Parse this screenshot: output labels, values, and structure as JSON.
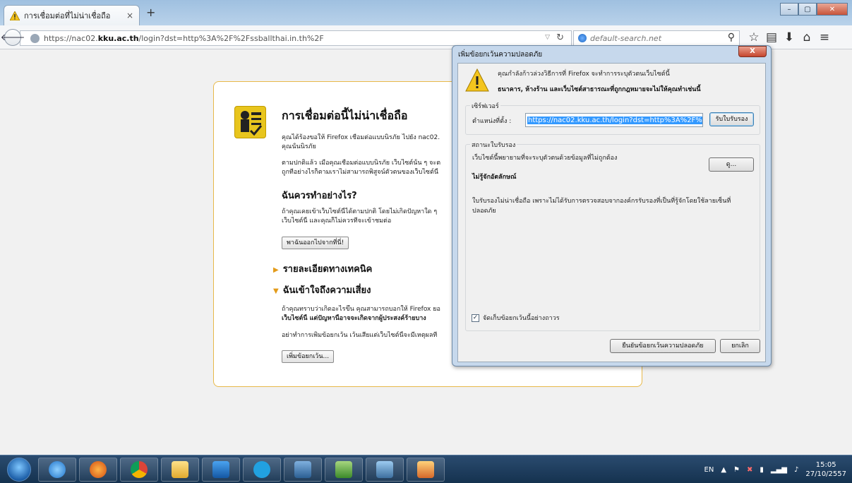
{
  "tab": {
    "title": "การเชื่อมต่อที่ไม่น่าเชื่อถือ",
    "close": "×",
    "new_tab": "+"
  },
  "window_controls": {
    "minimize": "–",
    "maximize": "▢",
    "close": "✕"
  },
  "navbar": {
    "url_prefix": "https://nac02.",
    "url_domain": "kku.ac.th",
    "url_rest": "/login?dst=http%3A%2F%2Fssballthai.in.th%2F",
    "search_placeholder": "default-search.net"
  },
  "error_page": {
    "title": "การเชื่อมต่อนี้ไม่น่าเชื่อถือ",
    "intro_1": "คุณได้ร้องขอให้ Firefox เชื่อมต่อแบบนิรภัย ไปยัง nac02.",
    "intro_2": "คุณนั้นนิรภัย",
    "normal_1": "ตามปกติแล้ว เมื่อคุณเชื่อมต่อแบบนิรภัย เว็บไซต์นั้น ๆ จะต",
    "normal_2": "ถูกที่อย่างไรก็ตามเราไม่สามารถพิสูจน์ตัวตนของเว็บไซต์นี้",
    "what_heading": "ฉันควรทำอย่างไร?",
    "what_1": "ถ้าคุณเคยเข้าเว็บไซต์นี้ได้ตามปกติ โดยไม่เกิดปัญหาใด ๆ",
    "what_2": "เว็บไซต์นี้ และคุณก็ไม่ควรที่จะเข้าชมต่อ",
    "get_out_button": "พาฉันออกไปจากที่นี่!",
    "technical_details": "รายละเอียดทางเทคนิค",
    "understand_risks": "ฉันเข้าใจถึงความเสี่ยง",
    "risk_1": "ถ้าคุณทราบว่าเกิดอะไรขึ้น คุณสามารถบอกให้ Firefox ยอ",
    "risk_2": "เว็บไซต์นี้ แต่ปัญหานี้อาจจะเกิดจากผู้ประสงค์ร้ายบาง",
    "risk_3": "อย่าทำการเพิ่มข้อยกเว้น เว้นเสียแต่เว็บไซต์นี้จะมีเหตุผลที่",
    "add_exception_button": "เพิ่มข้อยกเว้น..."
  },
  "dialog": {
    "title": "เพิ่มข้อยกเว้นความปลอดภัย",
    "close": "X",
    "warning_line": "คุณกำลังก้าวล่วงวิธีการที่ Firefox จะทำการระบุตัวตนเว็บไซต์นี้",
    "warning_bold": "ธนาคาร, ห้างร้าน และเว็บไซต์สาธารณะที่ถูกกฎหมายจะไม่ให้คุณทำเช่นนี้",
    "server_group": "เซิร์ฟเวอร์",
    "location_label": "ตำแหน่งที่ตั้ง :",
    "location_value": "https://nac02.kku.ac.th/login?dst=http%3A%2F%2Fssb",
    "get_cert_button": "รับใบรับรอง",
    "cert_status_group": "สถานะใบรับรอง",
    "cert_status_text": "เว็บไซต์นี้พยายามที่จะระบุตัวตนด้วยข้อมูลที่ไม่ถูกต้อง",
    "view_button": "ดู...",
    "unknown_identity": "ไม่รู้จักอัตลักษณ์",
    "untrusted_1": "ใบรับรองไม่น่าเชื่อถือ เพราะไม่ได้รับการตรวจสอบจากองค์กรรับรองที่เป็นที่รู้จักโดยใช้ลายเซ็นที่",
    "untrusted_2": "ปลอดภัย",
    "permanent_label": "จัดเก็บข้อยกเว้นนี้อย่างถาวร",
    "permanent_checked": true,
    "confirm_button": "ยืนยันข้อยกเว้นความปลอดภัย",
    "cancel_button": "ยกเลิก"
  },
  "taskbar": {
    "language": "EN",
    "time": "15:05",
    "date": "27/10/2557"
  }
}
